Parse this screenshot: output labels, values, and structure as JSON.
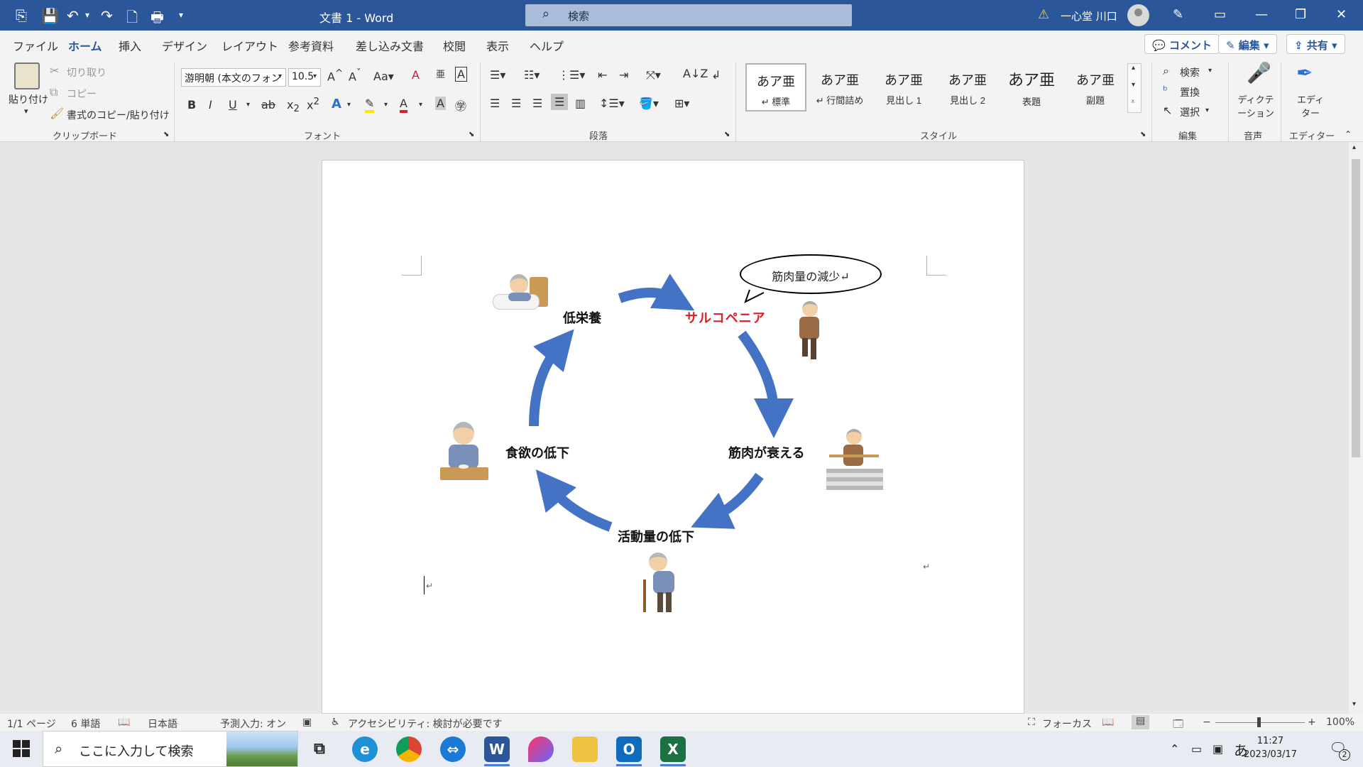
{
  "titlebar": {
    "title": "文書 1  -  Word",
    "search_placeholder": "検索",
    "user_name": "一心堂 川口"
  },
  "tabs": [
    "ファイル",
    "ホーム",
    "挿入",
    "デザイン",
    "レイアウト",
    "参考資料",
    "差し込み文書",
    "校閲",
    "表示",
    "ヘルプ"
  ],
  "tab_active": "ホーム",
  "tab_actions": {
    "comment": "コメント",
    "edit": "編集",
    "share": "共有"
  },
  "ribbon": {
    "clipboard": {
      "paste": "貼り付け",
      "cut": "切り取り",
      "copy": "コピー",
      "format_painter": "書式のコピー/貼り付け",
      "label": "クリップボード"
    },
    "font": {
      "font_name": "游明朝 (本文のフォン",
      "font_size": "10.5",
      "label": "フォント"
    },
    "paragraph": {
      "label": "段落"
    },
    "styles": {
      "label": "スタイル",
      "items": [
        {
          "sample": "あア亜",
          "name": "↵ 標準"
        },
        {
          "sample": "あア亜",
          "name": "↵ 行間詰め"
        },
        {
          "sample": "あア亜",
          "name": "見出し 1"
        },
        {
          "sample": "あア亜",
          "name": "見出し 2"
        },
        {
          "sample": "あア亜",
          "name": "表題"
        },
        {
          "sample": "あア亜",
          "name": "副題"
        }
      ]
    },
    "editing": {
      "find": "検索",
      "replace": "置換",
      "select": "選択",
      "label": "編集"
    },
    "voice": {
      "dictate": "ディクテーション",
      "label": "音声"
    },
    "editor": {
      "button": "エディター",
      "label": "エディター"
    }
  },
  "document": {
    "nodes": {
      "low_nutrition": "低栄養",
      "sarcopenia": "サルコペニア",
      "muscle_weakens": "筋肉が衰える",
      "activity_decline": "活動量の低下",
      "appetite_decline": "食欲の低下"
    },
    "bubble": "筋肉量の減少↵",
    "colors": {
      "arrow": "#4472c4",
      "sarcopenia": "#e31b23"
    }
  },
  "statusbar": {
    "page": "1/1 ページ",
    "words": "6 単語",
    "language": "日本語",
    "predictive": "予測入力: オン",
    "accessibility": "アクセシビリティ: 検討が必要です",
    "focus": "フォーカス",
    "zoom": "100%"
  },
  "taskbar": {
    "search_placeholder": "ここに入力して検索",
    "time": "11:27",
    "date": "2023/03/17",
    "notifications": "2",
    "ime": "あ"
  }
}
